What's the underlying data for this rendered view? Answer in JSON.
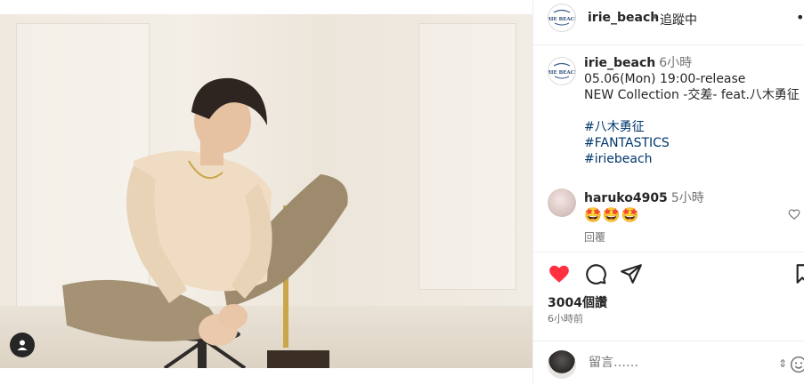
{
  "post": {
    "username": "irie_beach",
    "separator": "•",
    "follow_status": "追蹤中",
    "more": "•"
  },
  "caption": {
    "username": "irie_beach",
    "time": "6小時",
    "lines": [
      "05.06(Mon) 19:00-release",
      "NEW Collection -交差- feat.八木勇征"
    ],
    "hashtags": [
      "#八木勇征",
      "#FANTASTICS",
      "#iriebeach"
    ]
  },
  "comment": {
    "username": "haruko4905",
    "time": "5小時",
    "text": "🤩🤩🤩",
    "reply_label": "回覆"
  },
  "stats": {
    "likes": "3004個讚",
    "posted": "6小時前"
  },
  "add_comment": {
    "placeholder": "留言……"
  },
  "logo": {
    "text": "IRIE BEACH"
  },
  "colors": {
    "like_red": "#ff3040",
    "hashtag_blue": "#00376b",
    "muted": "#737373"
  },
  "icons": [
    "user-tag-icon",
    "more-icon",
    "like-icon",
    "comment-icon",
    "share-icon",
    "save-icon",
    "comment-like-icon",
    "emoji-icon"
  ]
}
